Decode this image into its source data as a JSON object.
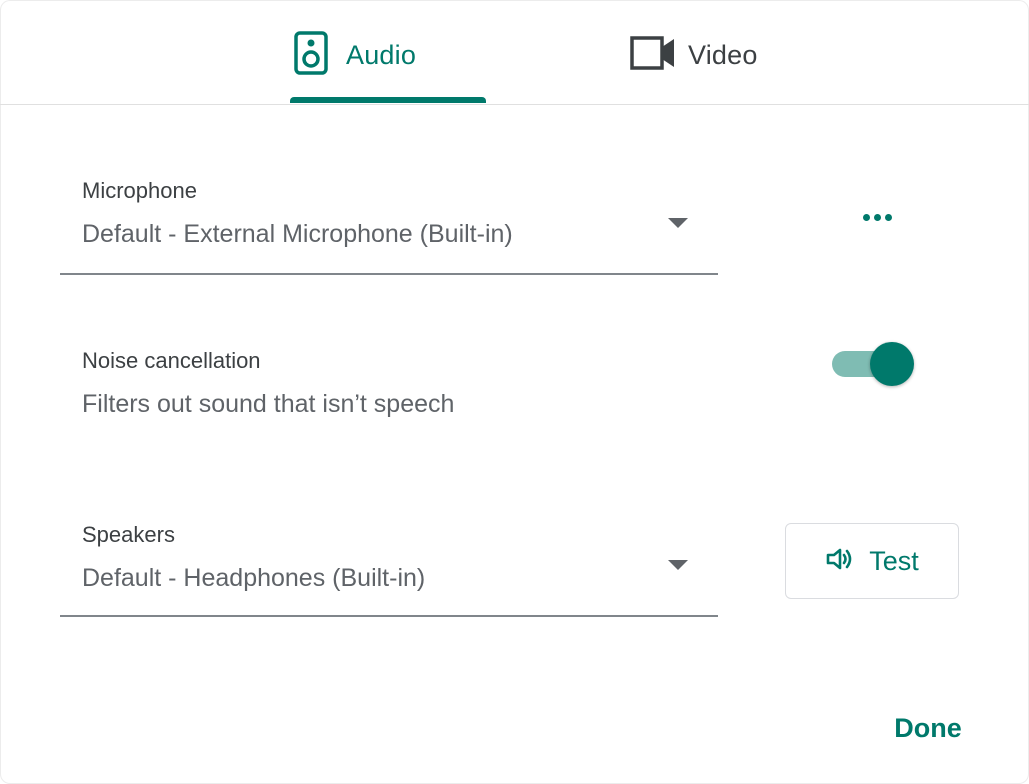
{
  "tabs": {
    "audio": {
      "label": "Audio",
      "icon": "speaker-icon",
      "selected": true
    },
    "video": {
      "label": "Video",
      "icon": "videocam-icon",
      "selected": false
    }
  },
  "microphone": {
    "label": "Microphone",
    "value": "Default - External Microphone (Built-in)"
  },
  "more_options": {
    "icon": "more-horiz-icon"
  },
  "noise_cancellation": {
    "title": "Noise cancellation",
    "description": "Filters out sound that isn’t speech",
    "enabled": true
  },
  "speakers": {
    "label": "Speakers",
    "value": "Default - Headphones (Built-in)"
  },
  "test_button": {
    "label": "Test",
    "icon": "volume-icon"
  },
  "done_button": {
    "label": "Done"
  },
  "colors": {
    "accent": "#00796b",
    "accent_light": "#7fbcb3",
    "text_primary": "#3c4043",
    "text_secondary": "#5f6368",
    "divider": "#e0e0e0"
  }
}
